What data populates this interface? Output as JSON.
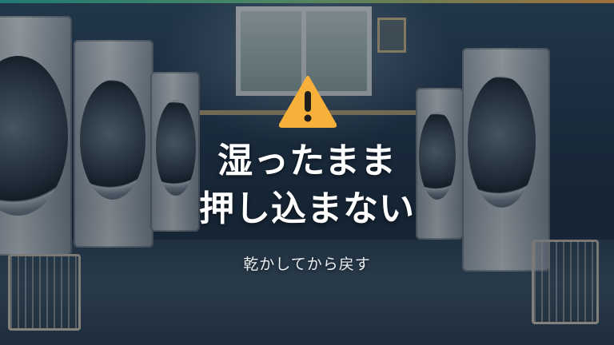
{
  "colors": {
    "accent_bar": [
      "#2bb3a3",
      "#6fc48a",
      "#f0a24a"
    ],
    "warning": "#f7b13a",
    "title": "#ffffff"
  },
  "icon": "warning-triangle-icon",
  "title_lines": [
    "湿ったまま",
    "押し込まない"
  ],
  "subtitle": "乾かしてから戻す"
}
